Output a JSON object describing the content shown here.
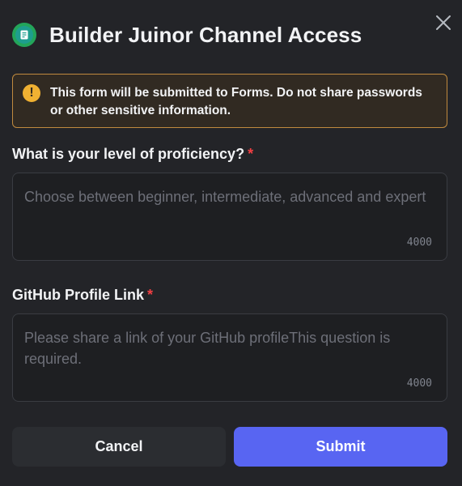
{
  "modal": {
    "title": "Builder Juinor Channel Access",
    "app_icon": "form-app-icon",
    "close_icon": "close-icon"
  },
  "notice": {
    "icon": "warning-icon",
    "icon_glyph": "!",
    "text_before": "This form will be submitted to ",
    "text_bold": "Forms",
    "text_after": ". Do not share passwords or other sensitive information."
  },
  "questions": [
    {
      "label": "What is your level of proficiency?",
      "required_mark": "*",
      "placeholder": "Choose between beginner, intermediate, advanced and expert",
      "value": "",
      "counter": "4000"
    },
    {
      "label": "GitHub Profile Link",
      "required_mark": "*",
      "placeholder": "Please share a link of your GitHub profileThis question is required.",
      "value": "",
      "counter": "4000"
    }
  ],
  "buttons": {
    "cancel_label": "Cancel",
    "submit_label": "Submit"
  },
  "colors": {
    "background": "#232428",
    "accent": "#5865f2",
    "required": "#f23f43",
    "warning": "#f0b132"
  }
}
